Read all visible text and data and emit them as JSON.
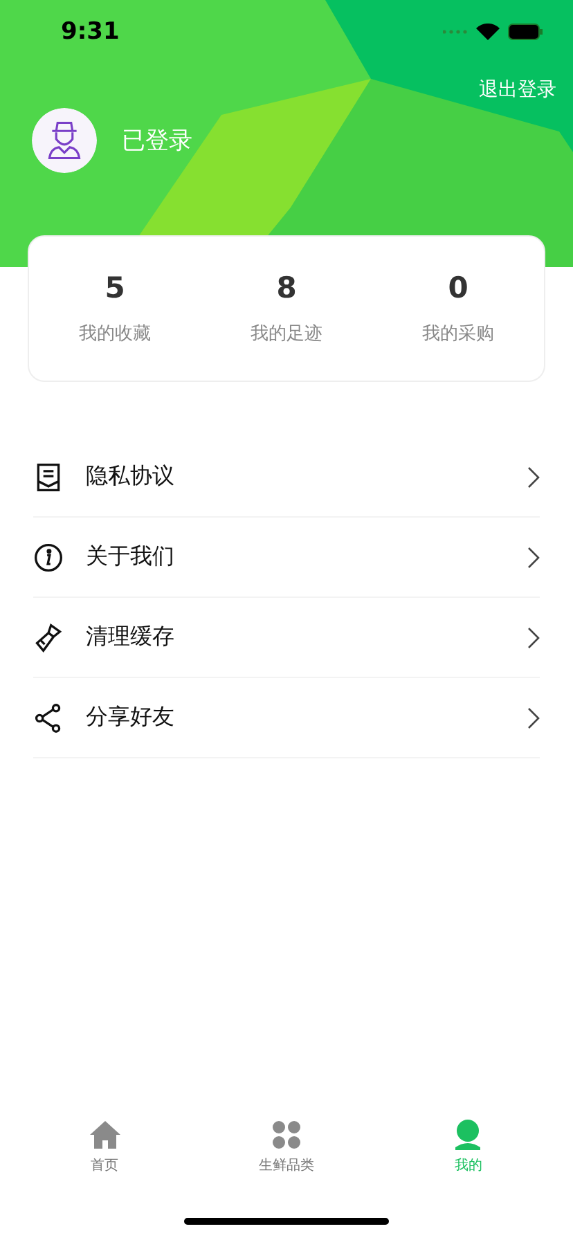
{
  "status_bar": {
    "time": "9:31"
  },
  "header": {
    "logout": "退出登录",
    "user_name": "已登录"
  },
  "stats": [
    {
      "value": "5",
      "label": "我的收藏"
    },
    {
      "value": "8",
      "label": "我的足迹"
    },
    {
      "value": "0",
      "label": "我的采购"
    }
  ],
  "menu": [
    {
      "kind": "document",
      "label": "隐私协议"
    },
    {
      "kind": "info",
      "label": "关于我们"
    },
    {
      "kind": "brush",
      "label": "清理缓存"
    },
    {
      "kind": "share",
      "label": "分享好友"
    }
  ],
  "tabs": [
    {
      "kind": "home",
      "label": "首页",
      "selected": false
    },
    {
      "kind": "grid",
      "label": "生鲜品类",
      "selected": false
    },
    {
      "kind": "person",
      "label": "我的",
      "selected": true
    }
  ]
}
